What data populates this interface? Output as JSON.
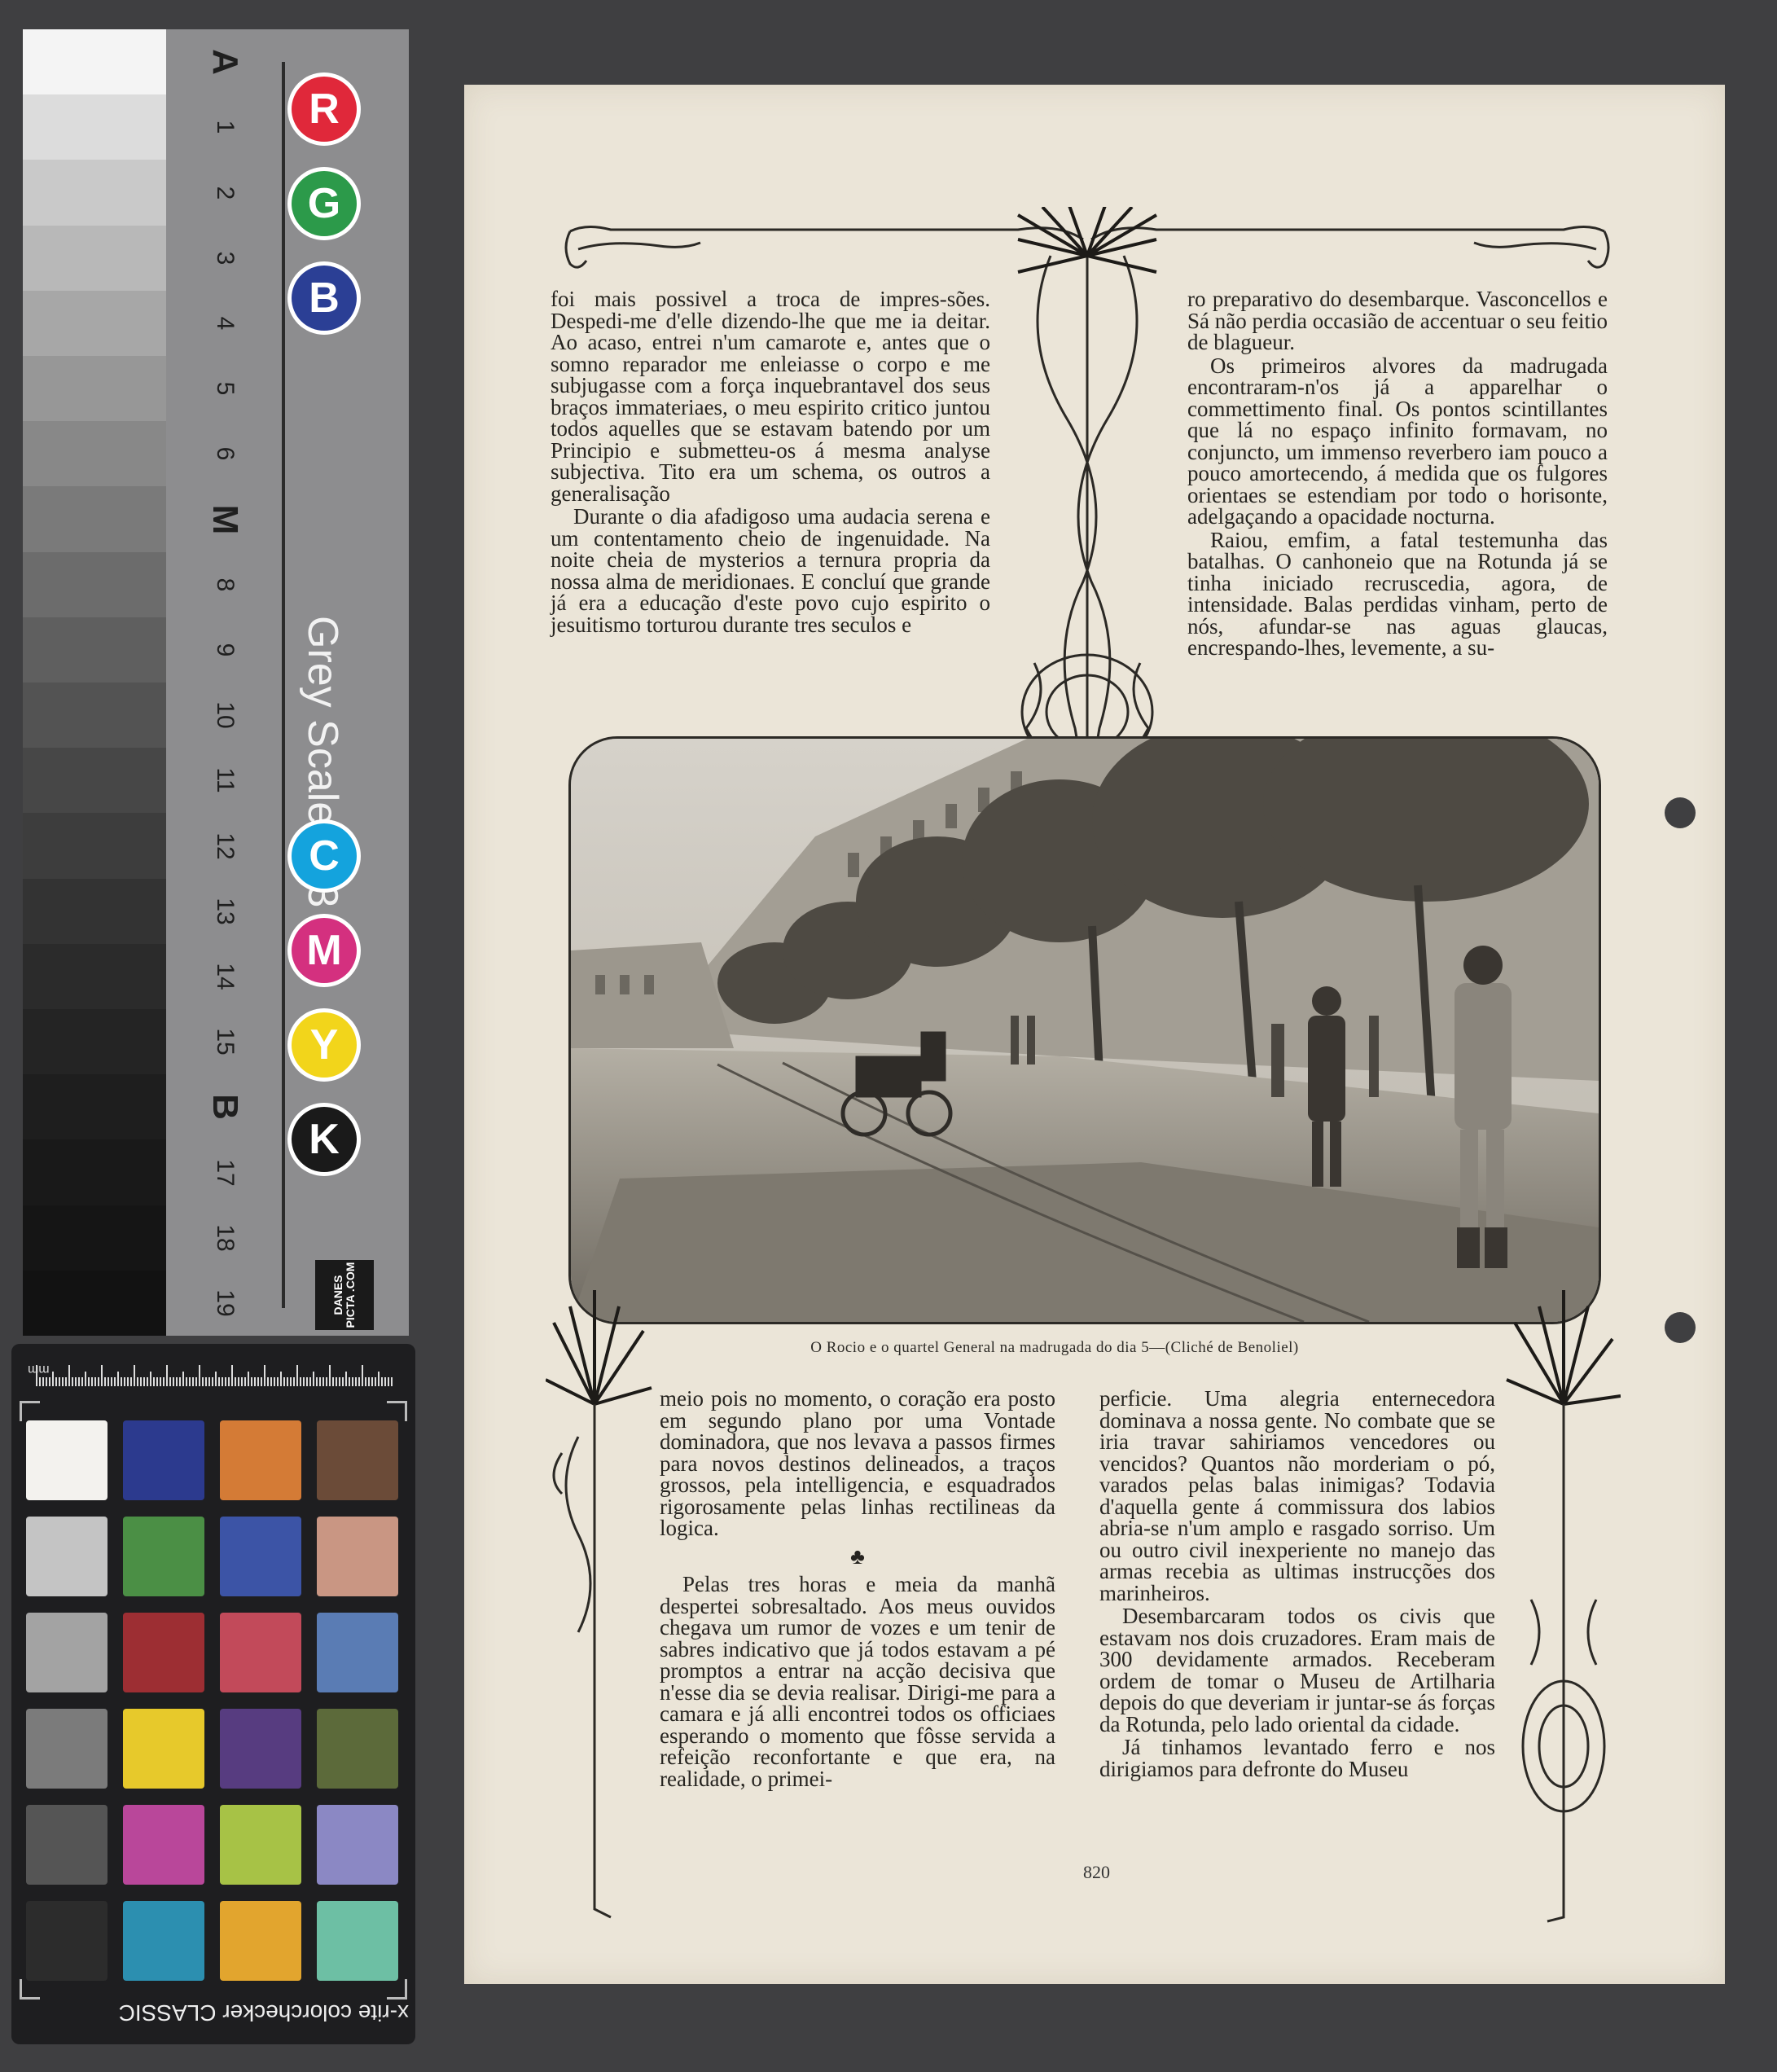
{
  "grey_target": {
    "title": "Grey Scale #13",
    "labels": [
      "A",
      "1",
      "2",
      "3",
      "4",
      "5",
      "6",
      "M",
      "8",
      "9",
      "10",
      "11",
      "12",
      "13",
      "14",
      "15",
      "B",
      "17",
      "18",
      "19"
    ],
    "patch_colors": [
      "#f4f4f4",
      "#dcdcdc",
      "#c9c9c9",
      "#b8b8b8",
      "#a7a7a7",
      "#979797",
      "#888888",
      "#7a7a7a",
      "#6c6c6c",
      "#5f5f5f",
      "#535353",
      "#474747",
      "#3d3d3d",
      "#333333",
      "#2b2b2b",
      "#242424",
      "#1e1e1e",
      "#191919",
      "#151515",
      "#121212"
    ],
    "rgb_dots": [
      {
        "letter": "R",
        "color": "#e0283a"
      },
      {
        "letter": "G",
        "color": "#2c9a4a"
      },
      {
        "letter": "B",
        "color": "#2b3f95"
      }
    ],
    "cmyk_dots": [
      {
        "letter": "C",
        "color": "#14a3dd"
      },
      {
        "letter": "M",
        "color": "#d4307f"
      },
      {
        "letter": "Y",
        "color": "#f2d51b"
      },
      {
        "letter": "K",
        "color": "#1a1a1a"
      }
    ],
    "logo_text": "DANES PICTA .COM"
  },
  "colorchecker": {
    "ruler_label": "mm",
    "brand": "x-rite colorchecker CLASSIC",
    "swatches": [
      "#f3f2ee",
      "#2c3a8e",
      "#d47b36",
      "#6b4b38",
      "#c4c4c4",
      "#4b8f45",
      "#3c54a6",
      "#c99683",
      "#a3a3a3",
      "#9d2e33",
      "#c24a5a",
      "#5a7cb4",
      "#7b7b7b",
      "#e7c92b",
      "#573c80",
      "#5c6a3a",
      "#555555",
      "#b9479a",
      "#a7c246",
      "#8b88c4",
      "#2c2c2c",
      "#2c8fb0",
      "#e2a52e",
      "#6dbfa4"
    ]
  },
  "article": {
    "col_top_left": [
      "foi mais possivel a troca de impres-sões. Despedi-me d'elle dizendo-lhe que me ia deitar. Ao acaso, entrei n'um camarote e, antes que o somno reparador me enleiasse o corpo e me subjugasse com a força inquebrantavel dos seus braços immateriaes, o meu espirito critico juntou todos aquelles que se estavam batendo por um Principio e submetteu-os á mesma analyse subjectiva. Tito era um schema, os outros a generalisação",
      "Durante o dia afadigoso uma audacia serena e um contentamento cheio de ingenuidade. Na noite cheia de mysterios a ternura propria da nossa alma de meridionaes. E concluí que grande já era a educação d'este povo cujo espirito o jesuitismo torturou durante tres seculos e"
    ],
    "col_top_right": [
      "ro preparativo do desembarque. Vasconcellos e Sá não perdia occasião de accentuar o seu feitio de blagueur.",
      "Os primeiros alvores da madrugada encontraram-n'os já a apparelhar o commettimento final. Os pontos scintillantes que lá no espaço infinito formavam, no conjuncto, um immenso reverbero iam pouco a pouco amortecendo, á medida que os fulgores orientaes se estendiam por todo o horisonte, adelgaçando a opacidade nocturna.",
      "Raiou, emfim, a fatal testemunha das batalhas. O canhoneio que na Rotunda já se tinha iniciado recruscedia, agora, de intensidade. Balas perdidas vinham, perto de nós, afundar-se nas aguas glaucas, encrespando-lhes, levemente, a su-"
    ],
    "photo_caption": "O Rocio e o quartel General na madrugada do dia 5—(Cliché de Benoliel)",
    "col_bottom_left": [
      "meio pois no momento, o coração era posto em segundo plano por uma Vontade dominadora, que nos levava a passos firmes para novos destinos delineados, a traços grossos, pela intelligencia, e esquadrados rigorosamente pelas linhas rectilineas da logica.",
      "♣",
      "Pelas tres horas e meia da manhã despertei sobresaltado. Aos meus ouvidos chegava um rumor de vozes e um tenir de sabres indicativo que já todos estavam a pé promptos a entrar na acção decisiva que n'esse dia se devia realisar. Dirigi-me para a camara e já alli encontrei todos os officiaes esperando o momento que fôsse servida a refeição reconfortante e que era, na realidade, o primei-"
    ],
    "col_bottom_right": [
      "perficie. Uma alegria enternecedora dominava a nossa gente. No combate que se iria travar sahiriamos vencedores ou vencidos? Quantos não morderiam o pó, varados pelas balas inimigas? Todavia d'aquella gente á commissura dos labios abria-se n'um amplo e rasgado sorriso. Um ou outro civil inexperiente no manejo das armas recebia as ultimas instrucções dos marinheiros.",
      "Desembarcaram todos os civis que estavam nos dois cruzadores. Eram mais de 300 devidamente armados. Receberam ordem de tomar o Museu de Artilharia depois do que deveriam ir juntar-se ás forças da Rotunda, pelo lado oriental da cidade.",
      "Já tinhamos levantado ferro e nos dirigiamos para defronte do Museu"
    ],
    "page_number": "820"
  }
}
